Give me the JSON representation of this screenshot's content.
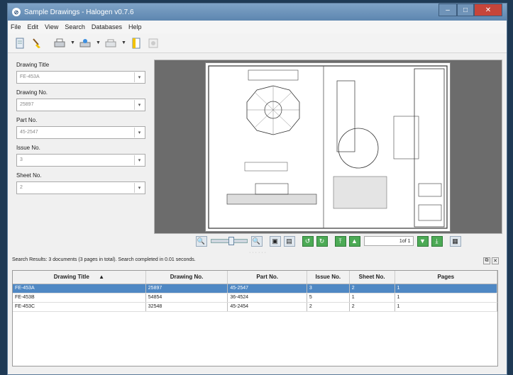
{
  "window": {
    "title": "Sample Drawings - Halogen v0.7.6"
  },
  "menu": [
    "File",
    "Edit",
    "View",
    "Search",
    "Databases",
    "Help"
  ],
  "toolbar": [
    "document-icon",
    "broom-icon",
    "print-icon",
    "scan-icon",
    "export-icon",
    "open-icon",
    "settings-icon"
  ],
  "filters": [
    {
      "label": "Drawing Title",
      "value": "FE-453A"
    },
    {
      "label": "Drawing No.",
      "value": "25897"
    },
    {
      "label": "Part No.",
      "value": "45-2547"
    },
    {
      "label": "Issue No.",
      "value": "3"
    },
    {
      "label": "Sheet No.",
      "value": "2"
    }
  ],
  "navigation": {
    "page_indicator": "1of 1"
  },
  "status": {
    "text": "Search Results: 3 documents (3 pages in total). Search completed in 0.01 seconds."
  },
  "table": {
    "headers": [
      "Drawing Title",
      "Drawing No.",
      "Part No.",
      "Issue No.",
      "Sheet No.",
      "Pages"
    ],
    "sort_indicator": "▲",
    "rows": [
      [
        "FE-453A",
        "25897",
        "45-2547",
        "3",
        "2",
        "1"
      ],
      [
        "FE-453B",
        "54854",
        "36-4524",
        "5",
        "1",
        "1"
      ],
      [
        "FE-453C",
        "32548",
        "45-2454",
        "2",
        "2",
        "1"
      ]
    ]
  }
}
